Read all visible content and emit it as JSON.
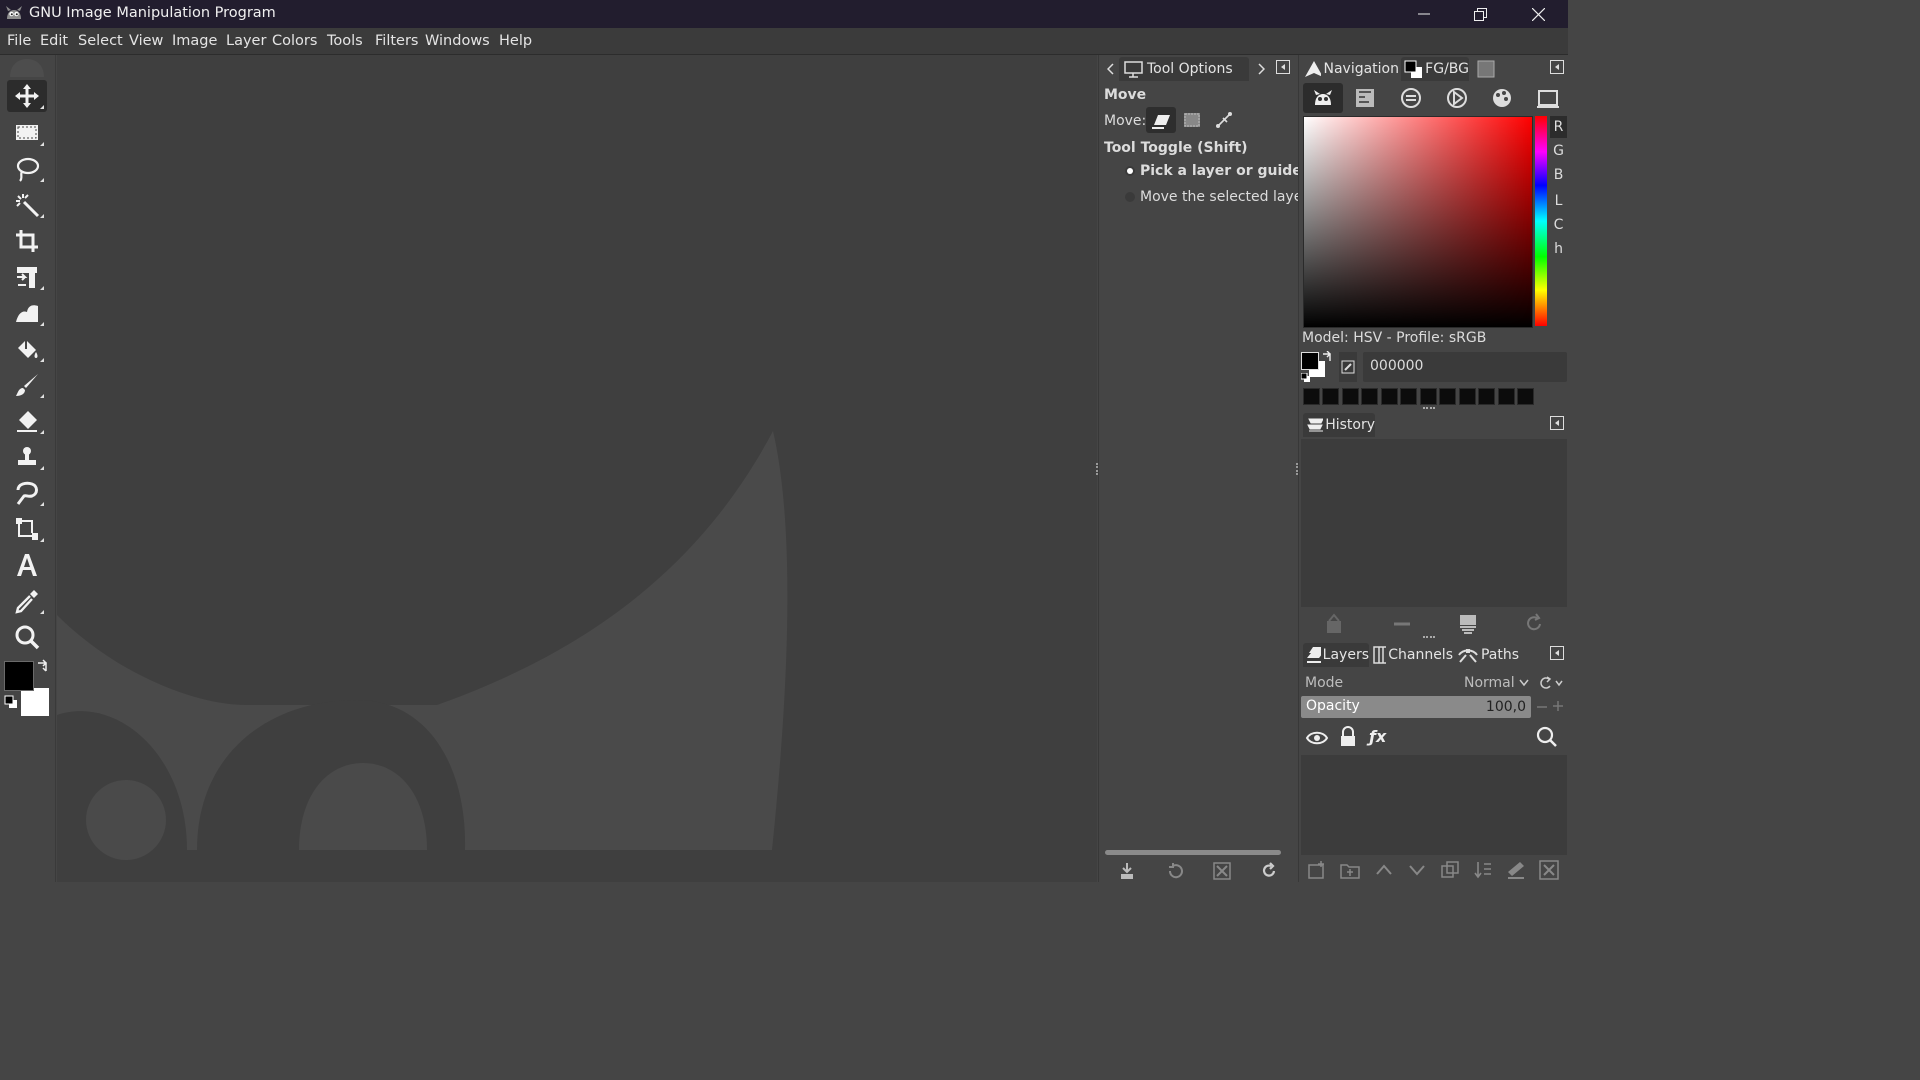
{
  "window": {
    "title": "GNU Image Manipulation Program",
    "controls": {
      "minimize": "minimize-icon",
      "maximize": "restore-icon",
      "close": "close-icon"
    }
  },
  "menubar": {
    "items": [
      "File",
      "Edit",
      "Select",
      "View",
      "Image",
      "Layer",
      "Colors",
      "Tools",
      "Filters",
      "Windows",
      "Help"
    ]
  },
  "toolbox": {
    "tools": [
      "move-tool-icon",
      "rect-select-tool-icon",
      "free-select-tool-icon",
      "fuzzy-select-tool-icon",
      "crop-tool-icon",
      "unified-transform-tool-icon",
      "warp-transform-tool-icon",
      "bucket-fill-tool-icon",
      "paintbrush-tool-icon",
      "eraser-tool-icon",
      "clone-tool-icon",
      "smudge-tool-icon",
      "paths-tool-icon",
      "text-tool-icon",
      "color-picker-tool-icon",
      "zoom-tool-icon"
    ],
    "active_tool": "move-tool-icon",
    "foreground_color": "#000000",
    "background_color": "#ffffff"
  },
  "tool_options": {
    "tab_label": "Tool Options",
    "heading": "Move",
    "move_label": "Move:",
    "toggle_label": "Tool Toggle  (Shift)",
    "radio_options": [
      {
        "label": "Pick a layer or guide",
        "selected": true
      },
      {
        "label": "Move the selected layer",
        "selected": false
      }
    ]
  },
  "colors_dock": {
    "tabs": [
      "Navigation",
      "FG/BG"
    ],
    "active_tab": "FG/BG",
    "channel_buttons": [
      "R",
      "G",
      "B",
      "L",
      "C",
      "h"
    ],
    "model_text": "Model: HSV - Profile: sRGB",
    "hex_value": "000000",
    "selected_hue_color": "#ff0000"
  },
  "history_dock": {
    "tab_label": "History"
  },
  "layers_dock": {
    "tabs": [
      "Layers",
      "Channels",
      "Paths"
    ],
    "mode_label": "Mode",
    "mode_value": "Normal",
    "opacity_label": "Opacity",
    "opacity_value": "100,0"
  },
  "colors": {
    "titlebar": "#221d2e",
    "canvas": "#3f3f3f",
    "wilber_shape": "#4a4a4a",
    "panel": "#454545"
  }
}
